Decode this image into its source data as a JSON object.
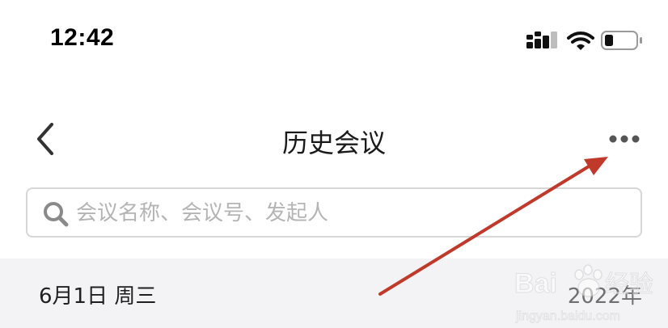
{
  "status_bar": {
    "time": "12:42",
    "icons": [
      "signal-icon",
      "wifi-icon",
      "battery-icon"
    ]
  },
  "nav": {
    "title": "历史会议",
    "back_icon": "chevron-left-icon",
    "more_icon": "more-dots-icon"
  },
  "search": {
    "placeholder": "会议名称、会议号、发起人",
    "value": "",
    "icon": "search-icon"
  },
  "meeting_list": {
    "sections": [
      {
        "date": "6月1日 周三",
        "year": "2022年"
      }
    ]
  },
  "watermark": {
    "text": "Baidu经验",
    "subtext": "jingyan.baidu.com"
  },
  "colors": {
    "annotation_arrow": "#c0392b",
    "section_background": "#f3f3f6",
    "placeholder": "#b4b4b4"
  }
}
